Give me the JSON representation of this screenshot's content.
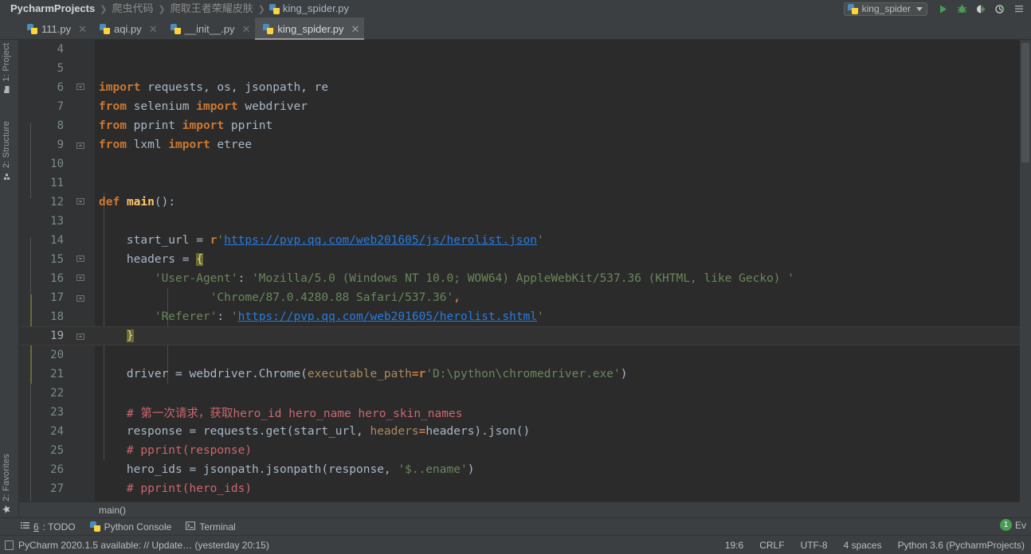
{
  "titlebar": {
    "breadcrumbs": [
      {
        "label": "PycharmProjects",
        "bold": true
      },
      {
        "label": "爬虫代码",
        "bold": false
      },
      {
        "label": "爬取王者荣耀皮肤",
        "bold": false
      },
      {
        "label": "king_spider.py",
        "bold": false
      }
    ],
    "separator": "❯",
    "run_config": "king_spider",
    "toolbar_icons": [
      "run-icon",
      "debug-icon",
      "coverage-icon",
      "profile-icon",
      "menu-icon"
    ]
  },
  "tabs": [
    {
      "label": "111.py",
      "active": false,
      "close": "✕"
    },
    {
      "label": "aqi.py",
      "active": false,
      "close": "✕"
    },
    {
      "label": "__init__.py",
      "active": false,
      "close": "✕"
    },
    {
      "label": "king_spider.py",
      "active": true,
      "close": "✕"
    }
  ],
  "left_tool_window": [
    {
      "label": "1: Project",
      "icon": "project-icon"
    },
    {
      "label": "2: Structure",
      "icon": "structure-icon"
    },
    {
      "label": "2: Favorites",
      "icon": "star-icon"
    }
  ],
  "editor": {
    "current_line": 19,
    "breadcrumb": "main()",
    "lines": [
      {
        "n": 4,
        "tokens": []
      },
      {
        "n": 5,
        "tokens": []
      },
      {
        "n": 6,
        "tokens": [
          {
            "t": "import",
            "c": "kw"
          },
          {
            "t": " requests, os, jsonpath, re",
            "c": "id"
          }
        ]
      },
      {
        "n": 7,
        "tokens": [
          {
            "t": "from",
            "c": "kw"
          },
          {
            "t": " selenium ",
            "c": "id"
          },
          {
            "t": "import",
            "c": "kw"
          },
          {
            "t": " webdriver",
            "c": "id"
          }
        ]
      },
      {
        "n": 8,
        "tokens": [
          {
            "t": "from",
            "c": "kw"
          },
          {
            "t": " pprint ",
            "c": "id"
          },
          {
            "t": "import",
            "c": "kw"
          },
          {
            "t": " pprint",
            "c": "id"
          }
        ]
      },
      {
        "n": 9,
        "tokens": [
          {
            "t": "from",
            "c": "kw"
          },
          {
            "t": " lxml ",
            "c": "id"
          },
          {
            "t": "import",
            "c": "kw"
          },
          {
            "t": " etree",
            "c": "id"
          }
        ]
      },
      {
        "n": 10,
        "tokens": []
      },
      {
        "n": 11,
        "tokens": []
      },
      {
        "n": 12,
        "tokens": [
          {
            "t": "def",
            "c": "kw"
          },
          {
            "t": " ",
            "c": "id"
          },
          {
            "t": "main",
            "c": "fn"
          },
          {
            "t": "():",
            "c": "id"
          }
        ]
      },
      {
        "n": 13,
        "tokens": []
      },
      {
        "n": 14,
        "tokens": [
          {
            "t": "    start_url = ",
            "c": "id"
          },
          {
            "t": "r",
            "c": "prefix"
          },
          {
            "t": "'",
            "c": "str"
          },
          {
            "t": "https://pvp.qq.com/web201605/js/herolist.json",
            "c": "url"
          },
          {
            "t": "'",
            "c": "str"
          }
        ]
      },
      {
        "n": 15,
        "tokens": [
          {
            "t": "    headers = ",
            "c": "id"
          },
          {
            "t": "{",
            "c": "brace-hl"
          }
        ]
      },
      {
        "n": 16,
        "tokens": [
          {
            "t": "        ",
            "c": "id"
          },
          {
            "t": "'User-Agent'",
            "c": "str"
          },
          {
            "t": ": ",
            "c": "id"
          },
          {
            "t": "'Mozilla/5.0 (Windows NT 10.0; WOW64) AppleWebKit/537.36 (KHTML, like Gecko) '",
            "c": "str"
          }
        ]
      },
      {
        "n": 17,
        "tokens": [
          {
            "t": "                ",
            "c": "id"
          },
          {
            "t": "'Chrome/87.0.4280.88 Safari/537.36'",
            "c": "str"
          },
          {
            "t": ",",
            "c": "kw"
          }
        ]
      },
      {
        "n": 18,
        "tokens": [
          {
            "t": "        ",
            "c": "id"
          },
          {
            "t": "'Referer'",
            "c": "str"
          },
          {
            "t": ": ",
            "c": "id"
          },
          {
            "t": "'",
            "c": "str"
          },
          {
            "t": "https://pvp.qq.com/web201605/herolist.shtml",
            "c": "url"
          },
          {
            "t": "'",
            "c": "str"
          }
        ]
      },
      {
        "n": 19,
        "tokens": [
          {
            "t": "    ",
            "c": "id"
          },
          {
            "t": "}",
            "c": "brace-hl"
          }
        ]
      },
      {
        "n": 20,
        "tokens": []
      },
      {
        "n": 21,
        "tokens": [
          {
            "t": "    driver = webdriver.Chrome(",
            "c": "id"
          },
          {
            "t": "executable_path",
            "c": "kwarg"
          },
          {
            "t": "=",
            "c": "kw"
          },
          {
            "t": "r",
            "c": "prefix"
          },
          {
            "t": "'D:\\python\\chromedriver.exe'",
            "c": "str"
          },
          {
            "t": ")",
            "c": "id"
          }
        ]
      },
      {
        "n": 22,
        "tokens": []
      },
      {
        "n": 23,
        "tokens": [
          {
            "t": "    # 第一次请求，获取hero_id hero_name hero_skin_names",
            "c": "cmtr"
          }
        ]
      },
      {
        "n": 24,
        "tokens": [
          {
            "t": "    response = requests.get(start_url, ",
            "c": "id"
          },
          {
            "t": "headers",
            "c": "kwarg"
          },
          {
            "t": "=",
            "c": "kw"
          },
          {
            "t": "headers).json()",
            "c": "id"
          }
        ]
      },
      {
        "n": 25,
        "tokens": [
          {
            "t": "    # pprint(response)",
            "c": "cmtr"
          }
        ]
      },
      {
        "n": 26,
        "tokens": [
          {
            "t": "    hero_ids = jsonpath.jsonpath(response, ",
            "c": "id"
          },
          {
            "t": "'$..ename'",
            "c": "str"
          },
          {
            "t": ")",
            "c": "id"
          }
        ]
      },
      {
        "n": 27,
        "tokens": [
          {
            "t": "    # pprint(hero_ids)",
            "c": "cmtr"
          }
        ]
      }
    ]
  },
  "bottom_tool_window": [
    {
      "label_prefix": "6",
      "label": ": TODO",
      "icon": "todo-icon"
    },
    {
      "label_prefix": "",
      "label": "Python Console",
      "icon": "python-console-icon"
    },
    {
      "label_prefix": "",
      "label": "Terminal",
      "icon": "terminal-icon"
    }
  ],
  "statusbar": {
    "message": "PyCharm 2020.1.5 available: // Update… (yesterday 20:15)",
    "message_icon": "notification-icon",
    "event_count": "1",
    "event_label": "Ev",
    "right": [
      {
        "name": "caret-position",
        "value": "19:6"
      },
      {
        "name": "line-separator",
        "value": "CRLF"
      },
      {
        "name": "file-encoding",
        "value": "UTF-8"
      },
      {
        "name": "indent",
        "value": "4 spaces"
      },
      {
        "name": "interpreter",
        "value": "Python 3.6 (PycharmProjects)"
      }
    ]
  },
  "colors": {
    "chrome_bg": "#3c3f41",
    "editor_bg": "#2b2b2b",
    "gutter_bg": "#313335",
    "current_line": "#323232",
    "keyword": "#cc7832",
    "string": "#6a8759",
    "comment_red": "#cc666e",
    "function": "#ffc66d",
    "link": "#287bde",
    "kwarg": "#aa8a5e",
    "accent_green": "#499c54"
  }
}
